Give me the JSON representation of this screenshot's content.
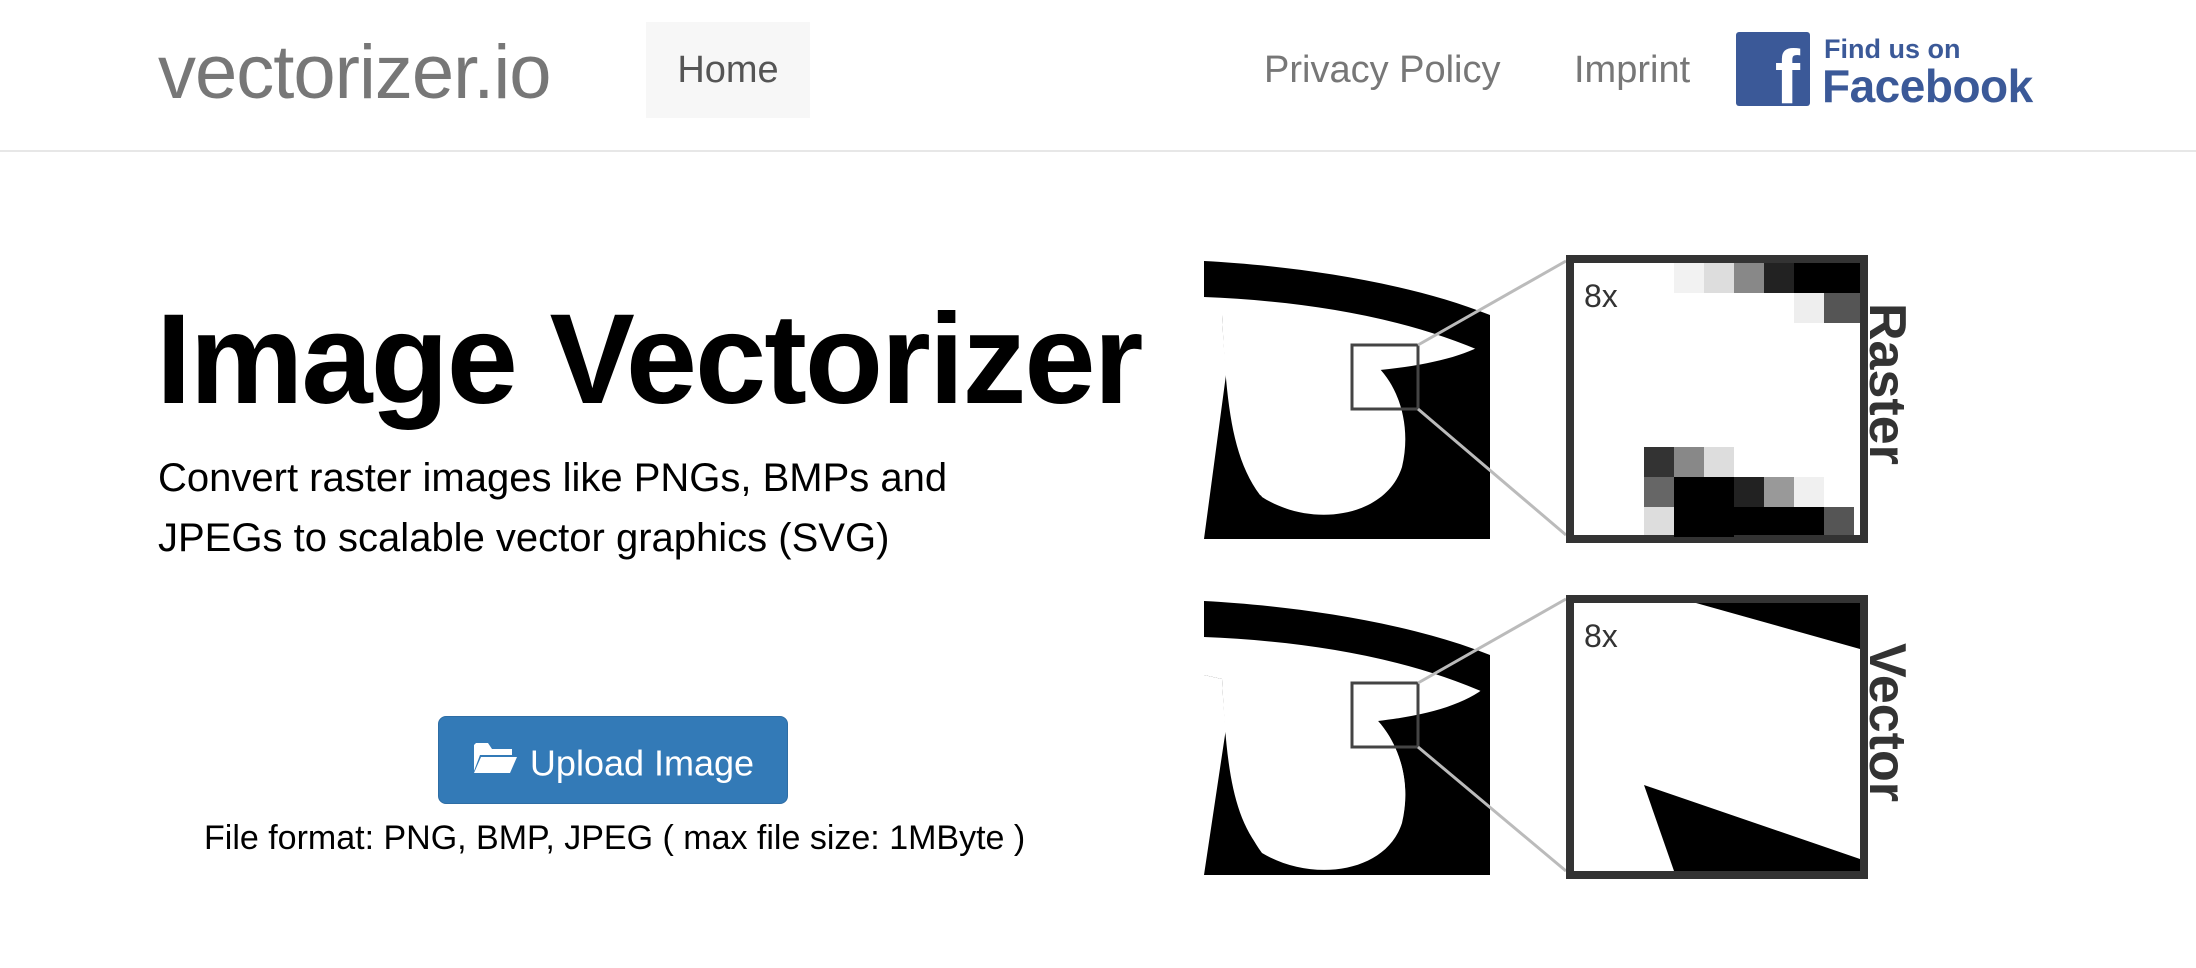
{
  "navbar": {
    "brand": "vectorizer.io",
    "links": {
      "home": "Home",
      "privacy": "Privacy Policy",
      "imprint": "Imprint"
    },
    "facebook": {
      "line1": "Find us on",
      "line2": "Facebook",
      "color": "#3b5998",
      "icon": "facebook-icon"
    }
  },
  "hero": {
    "title": "Image Vectorizer",
    "subtitle": "Convert raster images like PNGs, BMPs and JPEGs to scalable vector graphics (SVG)",
    "upload_button": {
      "label": "Upload Image",
      "icon": "folder-open-icon",
      "color": "#337ab7"
    },
    "file_format": "File format: PNG, BMP, JPEG ( max file size: 1MByte )"
  },
  "comparison": {
    "raster": {
      "zoom": "8x",
      "label": "Raster"
    },
    "vector": {
      "zoom": "8x",
      "label": "Vector"
    }
  }
}
